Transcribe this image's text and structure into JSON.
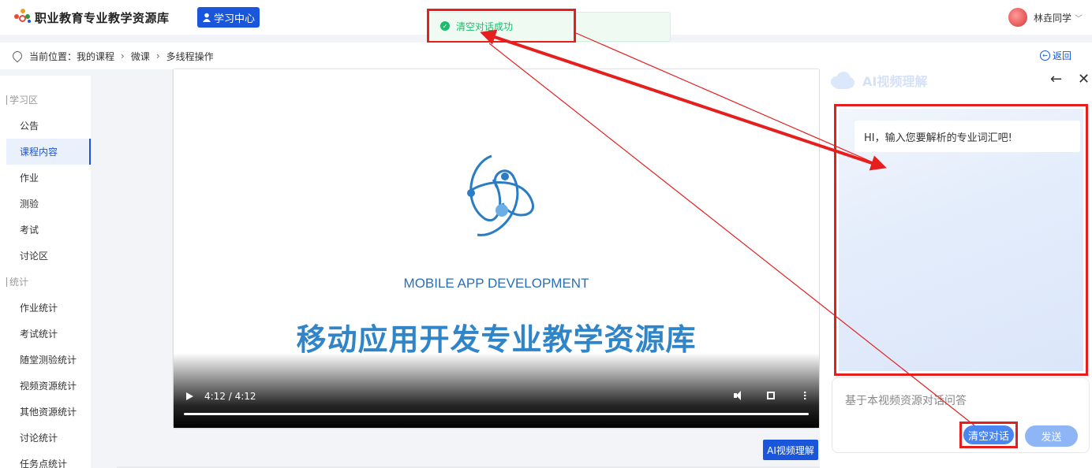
{
  "header": {
    "logo_title": "职业教育专业教学资源库",
    "study_center_label": "学习中心",
    "user_name": "林垚同学"
  },
  "toast": {
    "message": "清空对话成功"
  },
  "breadcrumb": {
    "prefix": "当前位置：",
    "items": [
      "我的课程",
      "微课",
      "多线程操作"
    ],
    "back_label": "返回"
  },
  "sidebar": {
    "sections": [
      {
        "title": "学习区",
        "items": [
          "公告",
          "课程内容",
          "作业",
          "测验",
          "考试",
          "讨论区"
        ]
      },
      {
        "title": "统计",
        "items": [
          "作业统计",
          "考试统计",
          "随堂测验统计",
          "视频资源统计",
          "其他资源统计",
          "讨论统计",
          "任务点统计"
        ]
      }
    ],
    "active_item": "课程内容"
  },
  "video": {
    "subtitle": "MOBILE APP DEVELOPMENT",
    "title": "移动应用开发专业教学资源库",
    "time": "4:12 / 4:12",
    "progress": 1.0
  },
  "ai_button_label": "AI视频理解",
  "ai_panel": {
    "title": "AI视频理解",
    "greeting": "HI，输入您要解析的专业词汇吧!",
    "input_placeholder": "基于本视频资源对话问答",
    "clear_label": "清空对话",
    "send_label": "发送"
  },
  "colors": {
    "primary": "#1a56db",
    "success": "#19be6b",
    "annotation": "#e51e1e"
  }
}
